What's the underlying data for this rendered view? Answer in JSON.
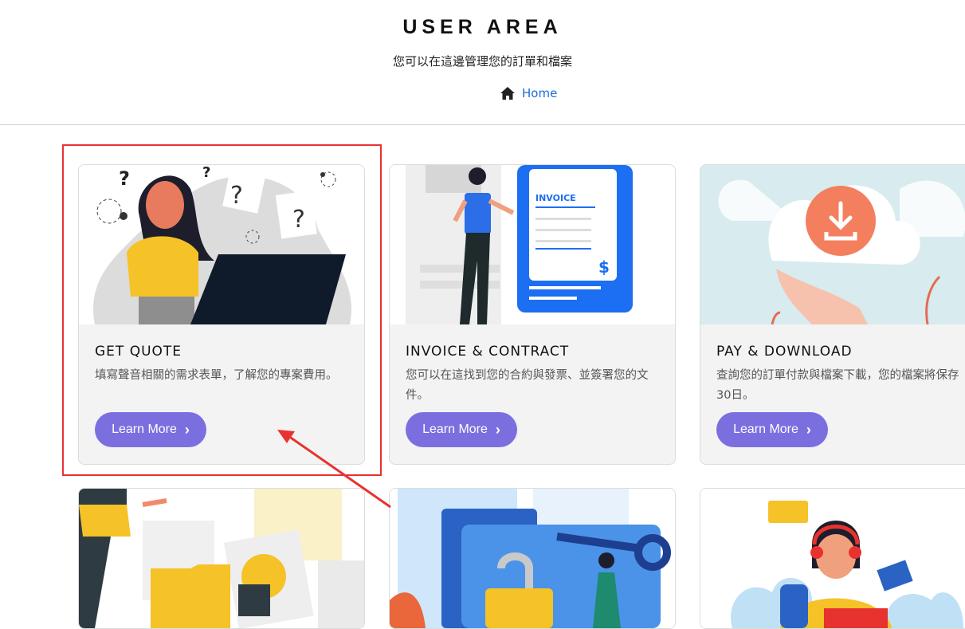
{
  "header": {
    "title": "USER AREA",
    "subtitle": "您可以在這邊管理您的訂單和檔案",
    "home_label": "Home"
  },
  "cards": [
    {
      "title": "GET QUOTE",
      "desc": "填寫聲音相關的需求表單，了解您的專案費用。",
      "button": "Learn More"
    },
    {
      "title": "INVOICE & CONTRACT",
      "desc": "您可以在這找到您的合約與發票、並簽署您的文件。",
      "button": "Learn More"
    },
    {
      "title": "PAY & DOWNLOAD",
      "desc": "查詢您的訂單付款與檔案下載，您的檔案將保存30日。",
      "button": "Learn More"
    }
  ],
  "invoice_art": {
    "label": "INVOICE",
    "currency": "$"
  },
  "colors": {
    "accent": "#7b6fe0",
    "link": "#1b6fd8",
    "highlight": "#e8322f"
  },
  "icons": [
    "home-icon",
    "chevron-right-icon",
    "download-icon"
  ]
}
